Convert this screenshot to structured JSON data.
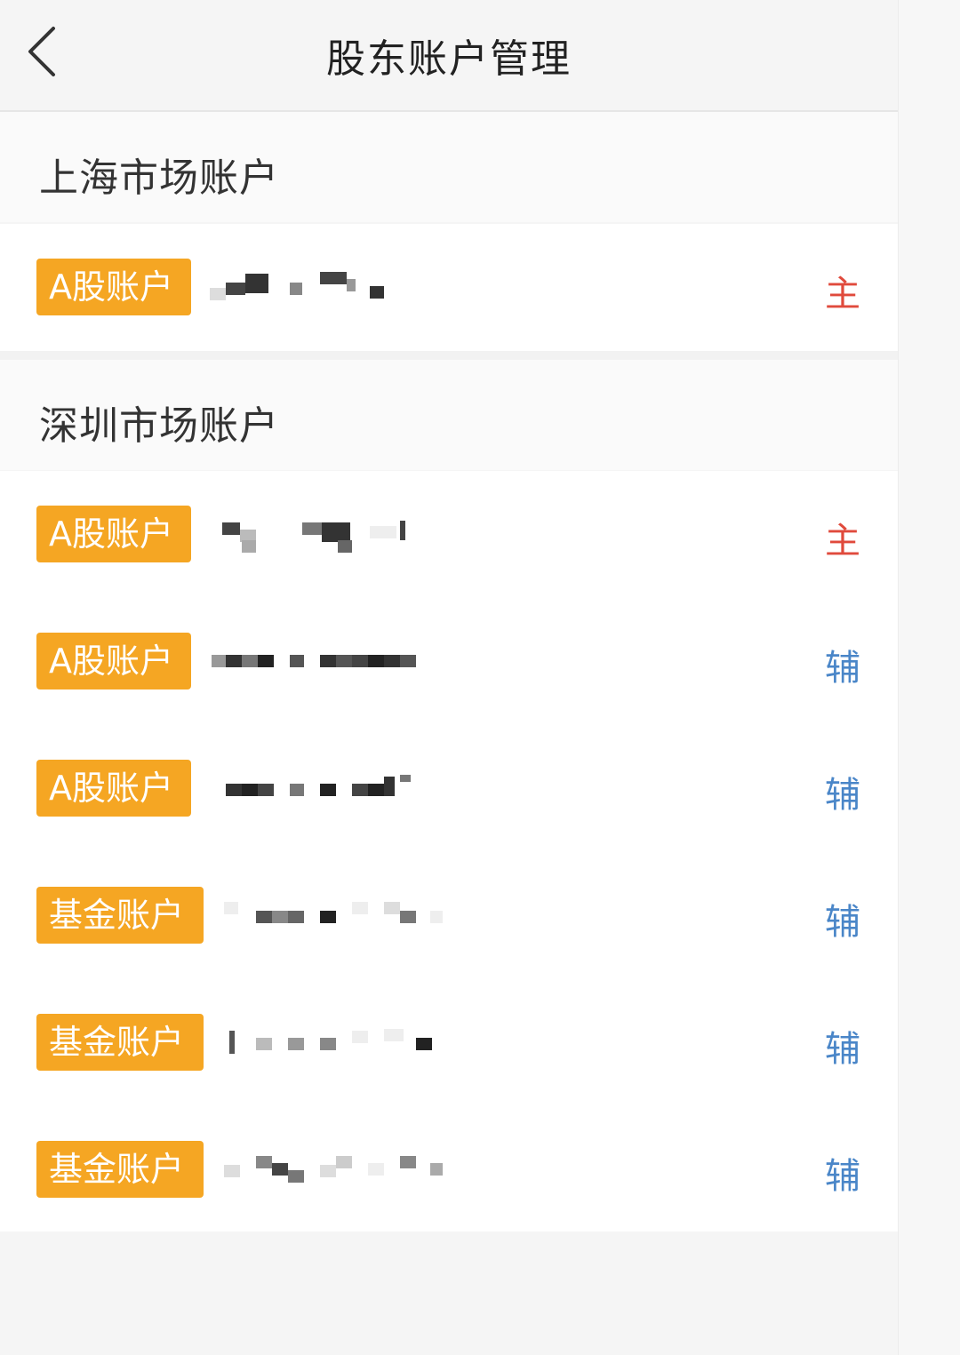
{
  "nav": {
    "title": "股东账户管理",
    "back_icon": "chevron-left-icon"
  },
  "sections": [
    {
      "title": "上海市场账户",
      "rows": [
        {
          "type": "A股账户",
          "role": "主",
          "role_kind": "main"
        }
      ]
    },
    {
      "title": "深圳市场账户",
      "rows": [
        {
          "type": "A股账户",
          "role": "主",
          "role_kind": "main"
        },
        {
          "type": "A股账户",
          "role": "辅",
          "role_kind": "aux"
        },
        {
          "type": "A股账户",
          "role": "辅",
          "role_kind": "aux"
        },
        {
          "type": "基金账户",
          "role": "辅",
          "role_kind": "aux"
        },
        {
          "type": "基金账户",
          "role": "辅",
          "role_kind": "aux"
        },
        {
          "type": "基金账户",
          "role": "辅",
          "role_kind": "aux"
        }
      ]
    }
  ],
  "colors": {
    "tag": "#f5a623",
    "main_role": "#e04a3c",
    "aux_role": "#4a86c8"
  }
}
